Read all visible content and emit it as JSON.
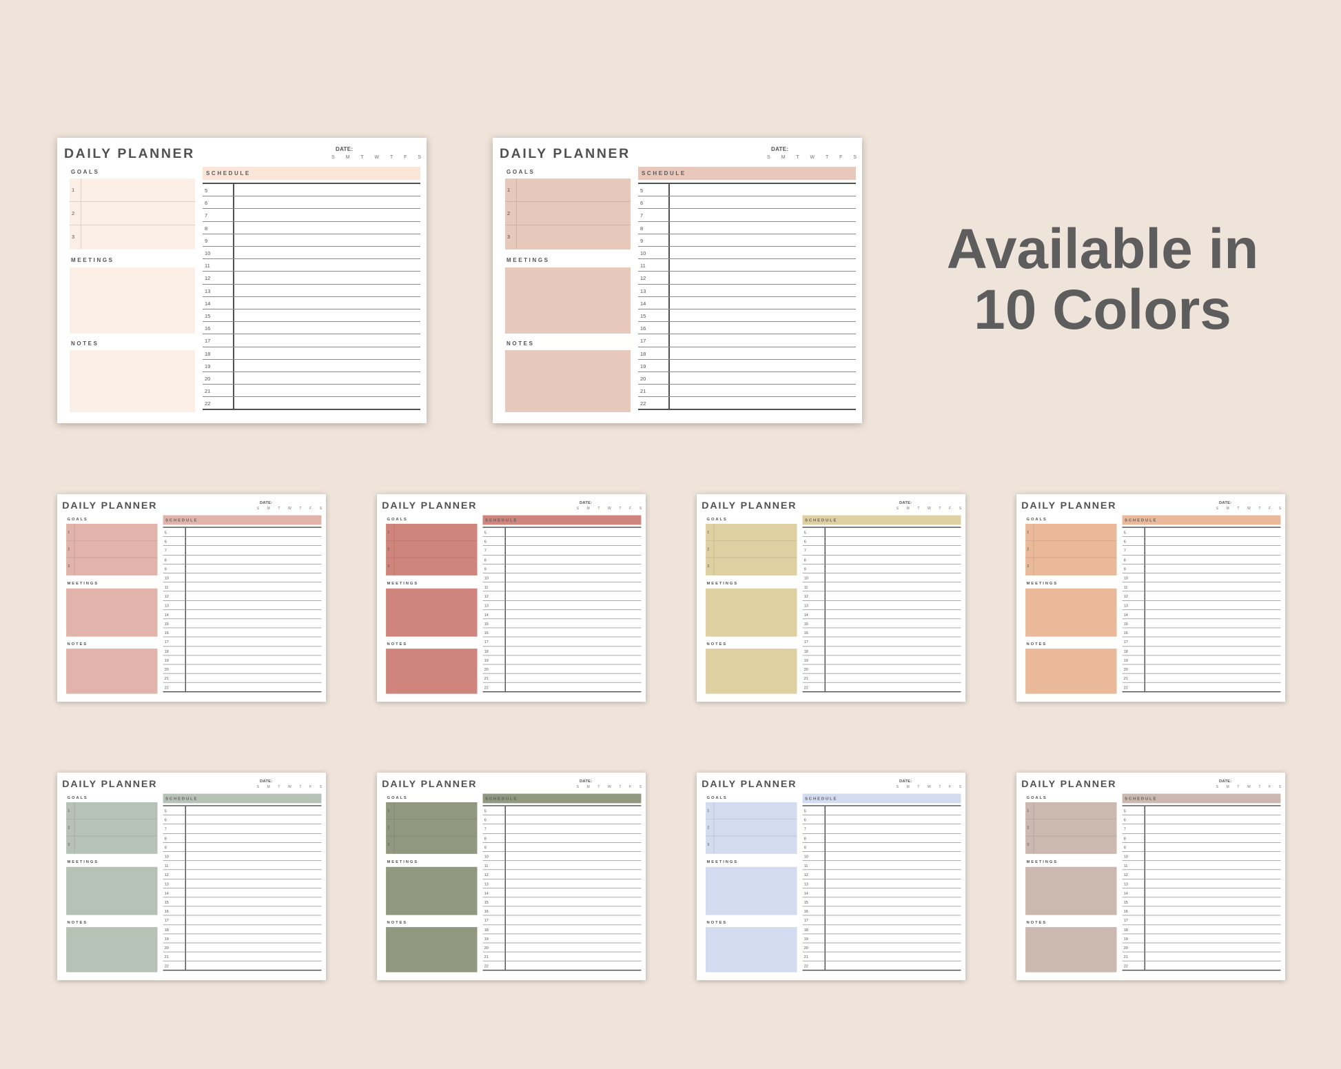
{
  "headline": {
    "line1": "Available in",
    "line2": "10 Colors"
  },
  "planner": {
    "title": "DAILY PLANNER",
    "date_label": "DATE:",
    "days": [
      "S",
      "M",
      "T",
      "W",
      "T",
      "F",
      "S"
    ],
    "goals_label": "GOALS",
    "goal_numbers": [
      "1",
      "2",
      "3"
    ],
    "meetings_label": "MEETINGS",
    "notes_label": "NOTES",
    "schedule_label": "SCHEDULE",
    "hours": [
      "5",
      "6",
      "7",
      "8",
      "9",
      "10",
      "11",
      "12",
      "13",
      "14",
      "15",
      "16",
      "17",
      "18",
      "19",
      "20",
      "21",
      "22"
    ]
  },
  "colors": [
    {
      "name": "cream",
      "box": "#fcefe6",
      "header": "#fbe6d9"
    },
    {
      "name": "rose",
      "box": "#e9c8bc",
      "header": "#e9c8bc"
    },
    {
      "name": "dusty-pink",
      "box": "#e1b3aa",
      "header": "#e1b3aa"
    },
    {
      "name": "terracotta",
      "box": "#cf857b",
      "header": "#cf857b"
    },
    {
      "name": "sand",
      "box": "#dfd0a2",
      "header": "#dfd0a2"
    },
    {
      "name": "peach",
      "box": "#e9b999",
      "header": "#e9b999"
    },
    {
      "name": "sage",
      "box": "#b7c2b6",
      "header": "#b7c2b6"
    },
    {
      "name": "olive",
      "box": "#929780",
      "header": "#929780"
    },
    {
      "name": "periwinkle",
      "box": "#d2dbef",
      "header": "#d2dbef"
    },
    {
      "name": "taupe",
      "box": "#cbb8ae",
      "header": "#cbb8ae"
    }
  ]
}
